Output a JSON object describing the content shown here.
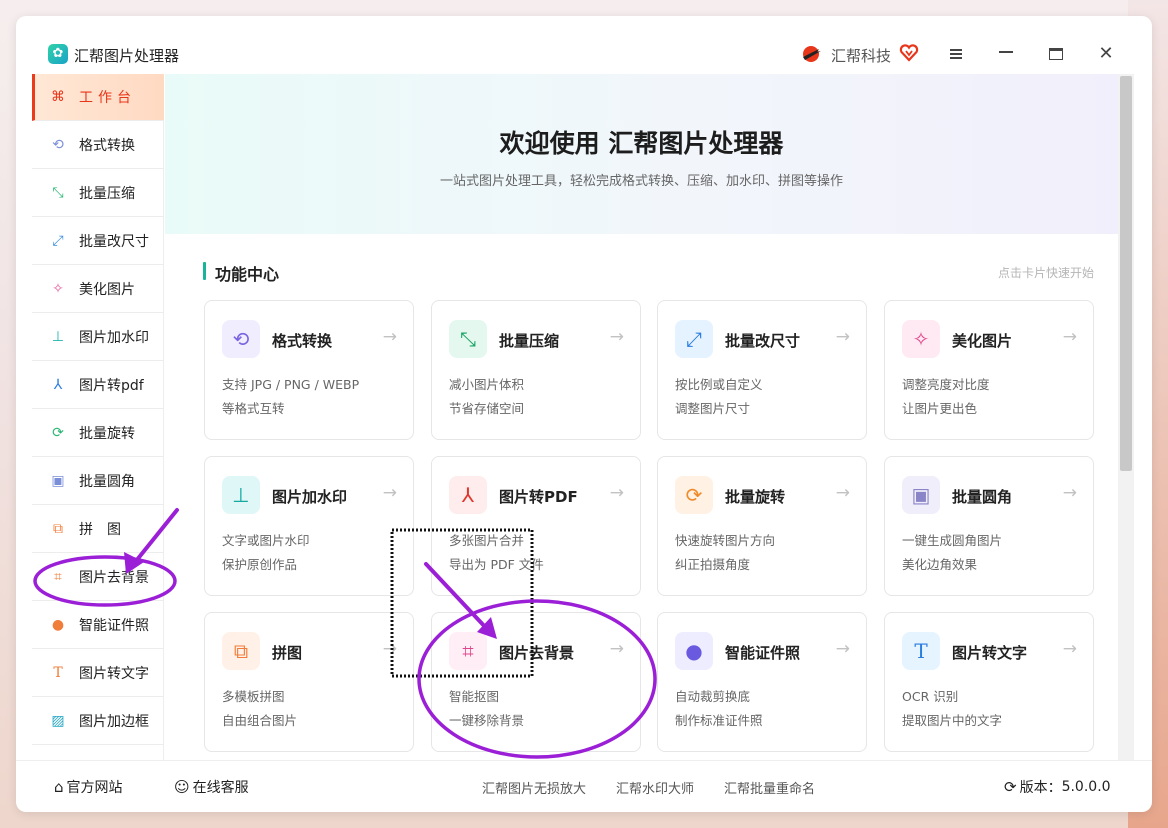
{
  "app": {
    "title": "汇帮图片处理器",
    "brand": "汇帮科技"
  },
  "sidebar": {
    "items": [
      {
        "label": "工作台",
        "icon": "grid-icon",
        "active": true
      },
      {
        "label": "格式转换",
        "icon": "convert-icon"
      },
      {
        "label": "批量压缩",
        "icon": "compress-icon"
      },
      {
        "label": "批量改尺寸",
        "icon": "resize-icon"
      },
      {
        "label": "美化图片",
        "icon": "magic-wand-icon"
      },
      {
        "label": "图片加水印",
        "icon": "stamp-icon"
      },
      {
        "label": "图片转pdf",
        "icon": "pdf-icon"
      },
      {
        "label": "批量旋转",
        "icon": "rotate-icon"
      },
      {
        "label": "批量圆角",
        "icon": "image-icon"
      },
      {
        "label": "拼图",
        "icon": "collage-icon"
      },
      {
        "label": "图片去背景",
        "icon": "crop-icon"
      },
      {
        "label": "智能证件照",
        "icon": "person-icon"
      },
      {
        "label": "图片转文字",
        "icon": "text-icon"
      },
      {
        "label": "图片加边框",
        "icon": "frame-icon"
      }
    ]
  },
  "hero": {
    "title": "欢迎使用 汇帮图片处理器",
    "subtitle": "一站式图片处理工具，轻松完成格式转换、压缩、加水印、拼图等操作"
  },
  "section": {
    "title": "功能中心",
    "hint": "点击卡片快速开始"
  },
  "cards": [
    {
      "title": "格式转换",
      "l1": "支持 JPG / PNG / WEBP",
      "l2": "等格式互转",
      "icon": "convert-icon"
    },
    {
      "title": "批量压缩",
      "l1": "减小图片体积",
      "l2": "节省存储空间",
      "icon": "compress-icon"
    },
    {
      "title": "批量改尺寸",
      "l1": "按比例或自定义",
      "l2": "调整图片尺寸",
      "icon": "resize-icon"
    },
    {
      "title": "美化图片",
      "l1": "调整亮度对比度",
      "l2": "让图片更出色",
      "icon": "magic-wand-icon"
    },
    {
      "title": "图片加水印",
      "l1": "文字或图片水印",
      "l2": "保护原创作品",
      "icon": "stamp-icon"
    },
    {
      "title": "图片转PDF",
      "l1": "多张图片合并",
      "l2": "导出为 PDF 文件",
      "icon": "pdf-icon"
    },
    {
      "title": "批量旋转",
      "l1": "快速旋转图片方向",
      "l2": "纠正拍摄角度",
      "icon": "rotate-icon"
    },
    {
      "title": "批量圆角",
      "l1": "一键生成圆角图片",
      "l2": "美化边角效果",
      "icon": "image-icon"
    },
    {
      "title": "拼图",
      "l1": "多模板拼图",
      "l2": "自由组合图片",
      "icon": "collage-icon"
    },
    {
      "title": "图片去背景",
      "l1": "智能抠图",
      "l2": "一键移除背景",
      "icon": "crop-icon"
    },
    {
      "title": "智能证件照",
      "l1": "自动裁剪换底",
      "l2": "制作标准证件照",
      "icon": "person-icon"
    },
    {
      "title": "图片转文字",
      "l1": "OCR 识别",
      "l2": "提取图片中的文字",
      "icon": "text-icon"
    }
  ],
  "footer": {
    "website": "官方网站",
    "support": "在线客服",
    "links": [
      "汇帮图片无损放大",
      "汇帮水印大师",
      "汇帮批量重命名"
    ],
    "version_label": "版本：",
    "version": "5.0.0.0"
  },
  "colors": {
    "accent": "#19b59a",
    "active_text": "#e8361b",
    "annotation": "#9b1fd6"
  },
  "arrow": "→"
}
